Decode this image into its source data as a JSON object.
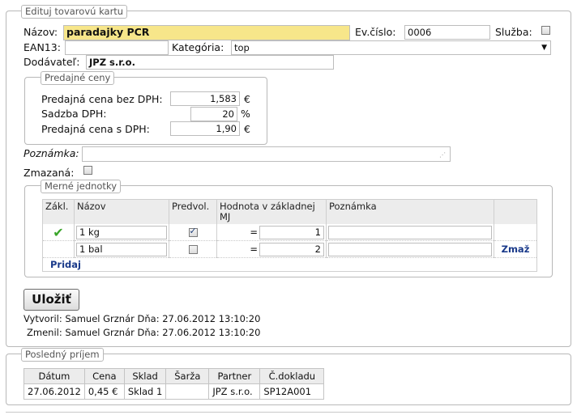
{
  "card": {
    "legend": "Edituj tovarovú kartu",
    "nazov_label": "Názov:",
    "nazov_value": "paradajky PCR",
    "evcislo_label": "Ev.číslo:",
    "evcislo_value": "0006",
    "sluzba_label": "Služba:",
    "sluzba_checked": false,
    "ean_label": "EAN13:",
    "ean_value": "",
    "kategoria_label": "Kategória:",
    "kategoria_value": "top",
    "dodavatel_label": "Dodávateľ:",
    "dodavatel_value": "JPZ s.r.o.",
    "poznamka_label": "Poznámka:",
    "poznamka_value": "",
    "zmazana_label": "Zmazaná:",
    "zmazana_checked": false
  },
  "prices": {
    "legend": "Predajné ceny",
    "bez_dph_label": "Predajná cena bez DPH:",
    "bez_dph_value": "1,583",
    "bez_dph_unit": "€",
    "sadzba_label": "Sadzba DPH:",
    "sadzba_value": "20",
    "sadzba_unit": "%",
    "s_dph_label": "Predajná cena s DPH:",
    "s_dph_value": "1,90",
    "s_dph_unit": "€"
  },
  "units": {
    "legend": "Merné jednotky",
    "headers": [
      "Zákl.",
      "Názov",
      "Predvol.",
      "Hodnota v základnej MJ",
      "Poznámka",
      ""
    ],
    "rows": [
      {
        "zakl": true,
        "nazov": "1 kg",
        "predvol": true,
        "eq": "=",
        "hodnota": "1",
        "poznamka": "",
        "action": ""
      },
      {
        "zakl": false,
        "nazov": "1 bal",
        "predvol": false,
        "eq": "=",
        "hodnota": "2",
        "poznamka": "",
        "action": "Zmaž"
      }
    ],
    "add_label": "Pridaj"
  },
  "save_label": "Uložiť",
  "audit": {
    "created": "Vytvoril: Samuel Grznár Dňa: 27.06.2012 13:10:20",
    "modified": "Zmenil: Samuel Grznár Dňa: 27.06.2012 13:10:20"
  },
  "last_receipt": {
    "legend": "Posledný príjem",
    "headers": [
      "Dátum",
      "Cena",
      "Sklad",
      "Šarža",
      "Partner",
      "Č.dokladu"
    ],
    "rows": [
      [
        "27.06.2012",
        "0,45 €",
        "Sklad 1",
        "",
        "JPZ s.r.o.",
        "SP12A001"
      ]
    ]
  },
  "colors": {
    "highlight_input": "#f7e68a",
    "check_green": "#3aa52a",
    "link_blue": "#1a3a8a"
  }
}
